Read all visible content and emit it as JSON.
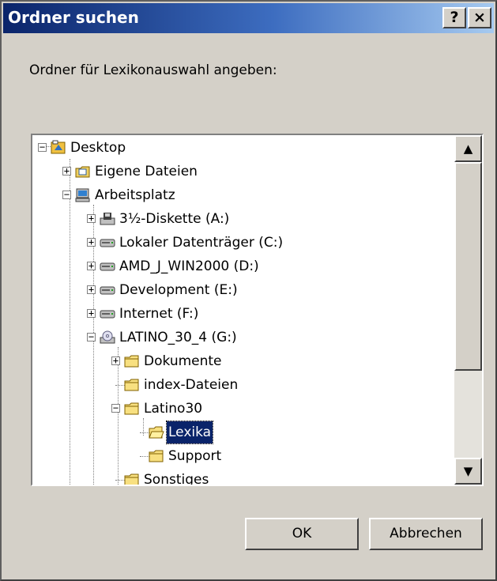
{
  "window": {
    "title": "Ordner suchen",
    "help_label": "?",
    "close_label": "×"
  },
  "instruction": "Ordner für Lexikonauswahl angeben:",
  "tree": {
    "items": [
      {
        "label": "Desktop",
        "icon": "desktop-icon",
        "expander": "−"
      },
      {
        "label": "Eigene Dateien",
        "icon": "my-documents-icon",
        "expander": "+"
      },
      {
        "label": "Arbeitsplatz",
        "icon": "my-computer-icon",
        "expander": "−"
      },
      {
        "label": "3½-Diskette (A:)",
        "icon": "floppy-drive-icon",
        "expander": "+"
      },
      {
        "label": "Lokaler Datenträger (C:)",
        "icon": "hard-drive-icon",
        "expander": "+"
      },
      {
        "label": "AMD_J_WIN2000 (D:)",
        "icon": "hard-drive-icon",
        "expander": "+"
      },
      {
        "label": "Development (E:)",
        "icon": "hard-drive-icon",
        "expander": "+"
      },
      {
        "label": "Internet (F:)",
        "icon": "hard-drive-icon",
        "expander": "+"
      },
      {
        "label": "LATINO_30_4 (G:)",
        "icon": "cd-drive-icon",
        "expander": "−"
      },
      {
        "label": "Dokumente",
        "icon": "folder-icon",
        "expander": "+"
      },
      {
        "label": "index-Dateien",
        "icon": "folder-icon",
        "expander": ""
      },
      {
        "label": "Latino30",
        "icon": "folder-icon",
        "expander": "−"
      },
      {
        "label": "Lexika",
        "icon": "open-folder-icon",
        "expander": "",
        "selected": true
      },
      {
        "label": "Support",
        "icon": "folder-icon",
        "expander": ""
      },
      {
        "label": "Sonstiges",
        "icon": "folder-icon",
        "expander": ""
      }
    ]
  },
  "scrollbar": {
    "up_label": "▲",
    "down_label": "▼"
  },
  "buttons": {
    "ok": "OK",
    "cancel": "Abbrechen"
  },
  "colors": {
    "title_bar": "#0a246a",
    "selection": "#0a246a",
    "face": "#d4d0c8"
  }
}
